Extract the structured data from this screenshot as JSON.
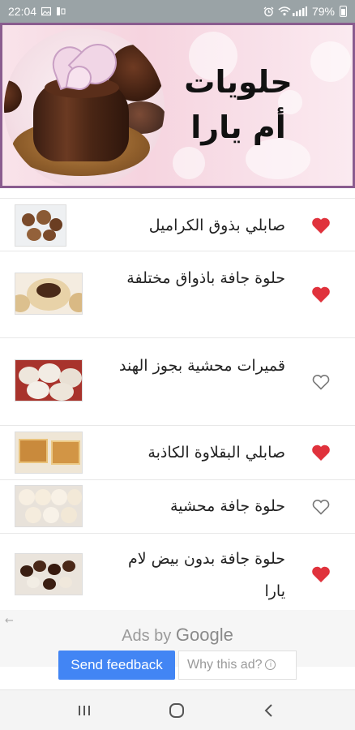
{
  "status_bar": {
    "time": "22:04",
    "battery": "79%",
    "icons": [
      "image-icon",
      "media-icon",
      "alarm-icon",
      "wifi-icon",
      "signal-icon",
      "battery-icon"
    ]
  },
  "banner": {
    "title_line1": "حلويات",
    "title_line2": "أم يارا"
  },
  "recipes": [
    {
      "title": "صابلي بذوق الكراميل",
      "favorite": true
    },
    {
      "title": "حلوة جافة باذواق مختلفة",
      "favorite": true
    },
    {
      "title": "قميرات محشية بجوز الهند",
      "favorite": false
    },
    {
      "title": "صابلي البقلاوة الكاذبة",
      "favorite": true
    },
    {
      "title": "حلوة جافة محشية",
      "favorite": false
    },
    {
      "title": "حلوة جافة بدون بيض لام يارا",
      "favorite": true
    }
  ],
  "ads": {
    "ads_by": "Ads by",
    "google": "Google",
    "send_feedback": "Send feedback",
    "why_this_ad": "Why this ad?"
  },
  "colors": {
    "heart": "#e0323c",
    "heart_outline": "#777777",
    "banner_border": "#8a5c8f",
    "feedback_button": "#4285f4"
  }
}
